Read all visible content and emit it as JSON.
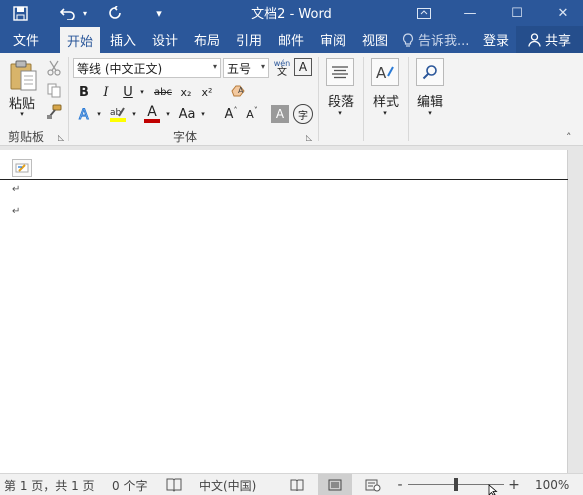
{
  "titlebar": {
    "title": "文档2 - Word",
    "qat_dropdown": "▾",
    "minimize": "—",
    "maximize": "☐",
    "close": "✕"
  },
  "tabs": [
    {
      "label": "文件"
    },
    {
      "label": "开始"
    },
    {
      "label": "插入"
    },
    {
      "label": "设计"
    },
    {
      "label": "布局"
    },
    {
      "label": "引用"
    },
    {
      "label": "邮件"
    },
    {
      "label": "审阅"
    },
    {
      "label": "视图"
    }
  ],
  "tell_me": "告诉我...",
  "login": "登录",
  "share": "共享",
  "ribbon": {
    "clipboard": {
      "paste": "粘贴",
      "label": "剪贴板"
    },
    "font": {
      "font_name": "等线 (中文正文)",
      "font_size": "五号",
      "phonetic_top": "wén",
      "phonetic_bottom": "文",
      "border_char": "A",
      "bold": "B",
      "italic": "I",
      "underline": "U",
      "strike": "abc",
      "subscript": "x₂",
      "superscript": "x²",
      "font_color": "A",
      "change_case": "Aa",
      "grow": "A",
      "shrink": "A",
      "shading": "A",
      "enclose": "字",
      "label": "字体"
    },
    "paragraph": {
      "label": "段落"
    },
    "styles": {
      "label": "样式"
    },
    "editing": {
      "label": "编辑"
    }
  },
  "document": {
    "paragraph_mark": "↵"
  },
  "status": {
    "page": "第 1 页，共 1 页",
    "words": "0 个字",
    "language": "中文(中国)",
    "zoom_out": "-",
    "zoom_in": "+",
    "zoom": "100%"
  },
  "colors": {
    "brand": "#2b579a",
    "highlight": "#ffff00",
    "font_color": "#c00000"
  }
}
